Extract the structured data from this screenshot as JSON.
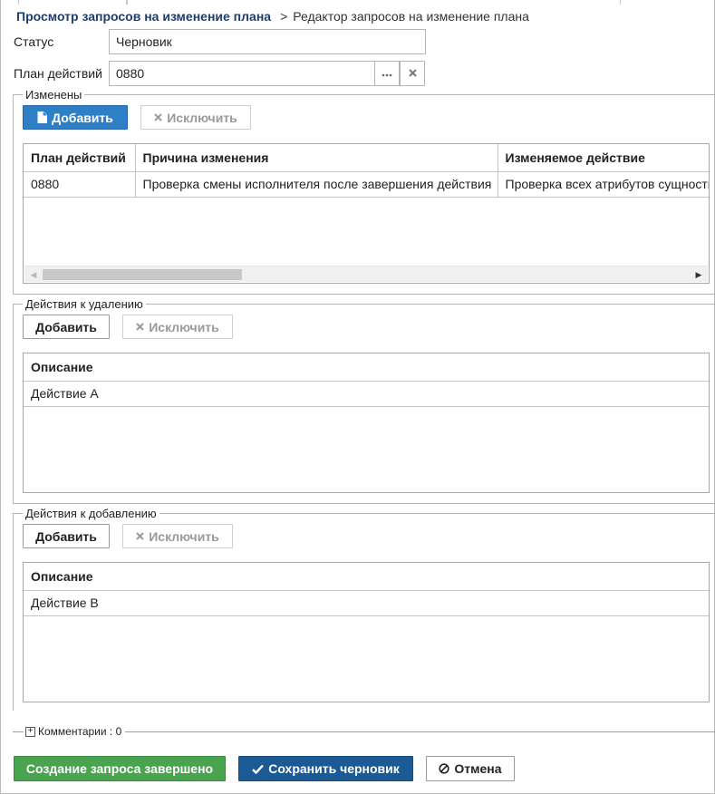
{
  "breadcrumb": {
    "parent": "Просмотр запросов на изменение плана",
    "separator": ">",
    "current": "Редактор запросов на изменение плана"
  },
  "form": {
    "status_label": "Статус",
    "status_value": "Черновик",
    "plan_label": "План действий",
    "plan_value": "0880"
  },
  "changed": {
    "legend": "Изменены",
    "add_label": "Добавить",
    "remove_label": "Исключить",
    "columns": [
      "План действий",
      "Причина изменения",
      "Изменяемое действие"
    ],
    "rows": [
      [
        "0880",
        "Проверка смены исполнителя после завершения действия",
        "Проверка всех атрибутов сущности"
      ]
    ]
  },
  "to_delete": {
    "legend": "Действия к удалению",
    "add_label": "Добавить",
    "remove_label": "Исключить",
    "columns": [
      "Описание"
    ],
    "rows": [
      [
        "Действие А"
      ]
    ]
  },
  "to_add": {
    "legend": "Действия к добавлению",
    "add_label": "Добавить",
    "remove_label": "Исключить",
    "columns": [
      "Описание"
    ],
    "rows": [
      [
        "Действие В"
      ]
    ]
  },
  "comments": {
    "label": "Комментарии : 0"
  },
  "footer": {
    "complete_label": "Создание запроса завершено",
    "save_label": "Сохранить черновик",
    "cancel_label": "Отмена"
  },
  "colors": {
    "primary": "#2f7fc6",
    "success": "#4aa34f",
    "dark_blue": "#1c5a96",
    "breadcrumb_link": "#1f3d6b"
  },
  "icons": {
    "add": "document-icon",
    "remove": "x-icon",
    "ellipsis": "ellipsis-icon",
    "clear": "x-icon",
    "save": "check-icon",
    "cancel": "no-icon",
    "expand": "plus-box-icon"
  }
}
